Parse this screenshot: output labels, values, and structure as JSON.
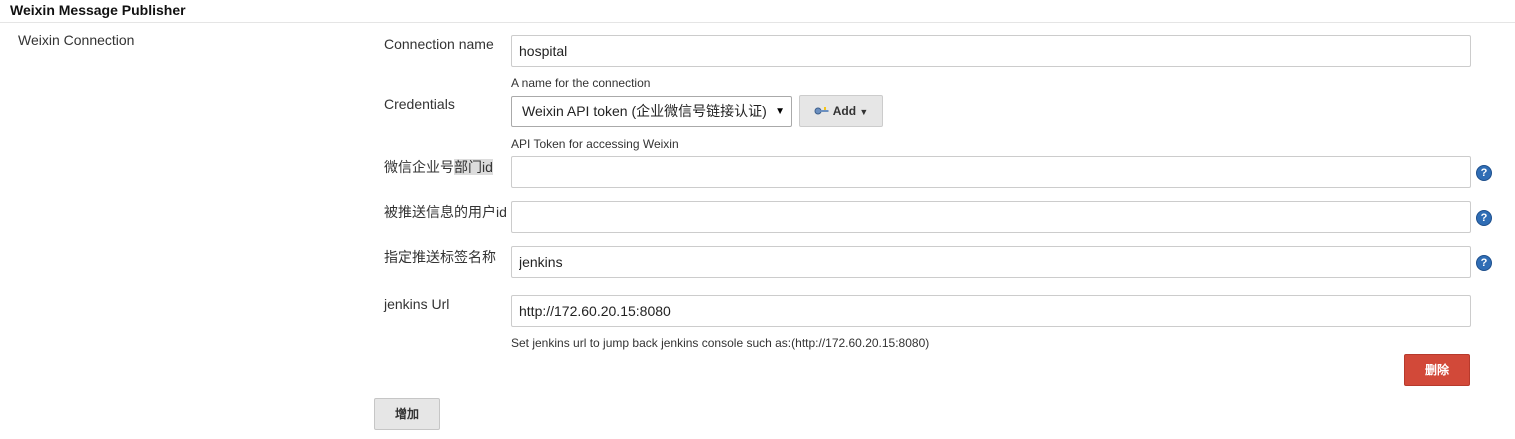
{
  "section": {
    "title": "Weixin Message Publisher"
  },
  "connection": {
    "label": "Weixin Connection"
  },
  "fields": {
    "connection_name": {
      "label": "Connection name",
      "value": "hospital",
      "hint": "A name for the connection"
    },
    "credentials": {
      "label": "Credentials",
      "selected": "Weixin API token (企业微信号链接认证)",
      "add_label": "Add",
      "hint": "API Token for accessing Weixin"
    },
    "dept_id": {
      "label_a": "微信企业号",
      "label_b": "部门id",
      "value": ""
    },
    "user_id": {
      "label": "被推送信息的用户id",
      "value": ""
    },
    "tag_name": {
      "label": "指定推送标签名称",
      "value": "jenkins"
    },
    "jenkins_url": {
      "label": "jenkins Url",
      "value": "http://172.60.20.15:8080",
      "hint": "Set jenkins url to jump back jenkins console such as:(http://172.60.20.15:8080)"
    }
  },
  "buttons": {
    "delete": "删除",
    "add": "增加"
  },
  "help_icon": "?",
  "colors": {
    "danger": "#d24939",
    "help": "#2f6db5"
  }
}
